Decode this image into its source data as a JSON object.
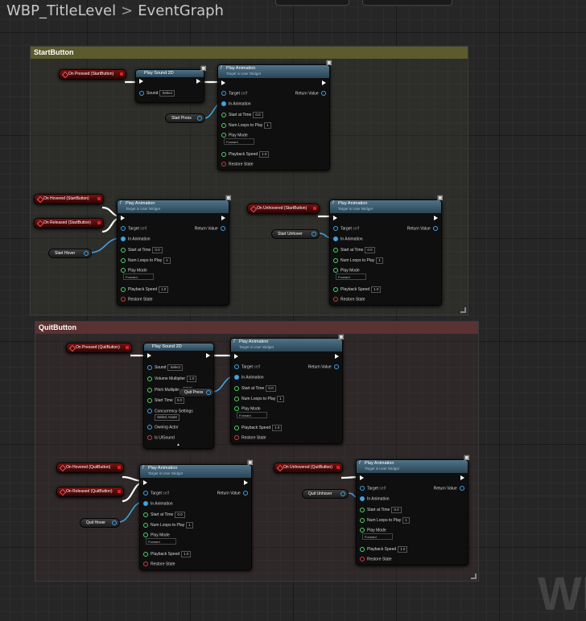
{
  "breadcrumb": {
    "blueprint": "WBP_TitleLevel",
    "separator": ">",
    "graph": "EventGraph"
  },
  "watermark": "WI",
  "colors": {
    "start_comment": "#5b5b2c",
    "quit_comment": "#5a3232",
    "exec_wire": "#ffffff",
    "data_wire": "#3fa3e5"
  },
  "comments": [
    {
      "title": "StartButton"
    },
    {
      "title": "QuitButton"
    }
  ],
  "play_sound": {
    "title": "Play Sound 2D",
    "sound_label": "Sound",
    "sound_value": "Select",
    "volume_label": "Volume Multiplier",
    "volume_value": "1.0",
    "pitch_label": "Pitch Multiplier",
    "pitch_value": "1.0",
    "start_time_label": "Start Time",
    "start_time_value": "0.0",
    "concurrency_label": "Concurrency Settings",
    "concurrency_value": "Select Asset",
    "owning_actor_label": "Owning Actor",
    "is_ui_sound_label": "Is UISound"
  },
  "play_anim": {
    "title": "Play Animation",
    "subtitle": "Target is User Widget",
    "target_label": "Target",
    "target_value": "self",
    "return_label": "Return Value",
    "in_anim_label": "In Animation",
    "start_label": "Start at Time",
    "start_value": "0.0",
    "loops_label": "Num Loops to Play",
    "loops_value": "1",
    "mode_label": "Play Mode",
    "mode_value": "Forward",
    "speed_label": "Playback Speed",
    "speed_value": "1.0",
    "restore_label": "Restore State"
  },
  "events": {
    "start_pressed": "On Pressed (StartButton)",
    "start_hovered": "On Hovered (StartButton)",
    "start_released": "On Released (StartButton)",
    "start_unhovered": "On Unhovered (StartButton)",
    "quit_pressed": "On Pressed (QuitButton)",
    "quit_hovered": "On Hovered (QuitButton)",
    "quit_released": "On Released (QuitButton)",
    "quit_unhovered": "On Unhovered (QuitButton)"
  },
  "variables": {
    "start_press": "Start Press",
    "start_hover": "Start Hover",
    "start_unhover": "Start Unhover",
    "quit_press": "Quit Press",
    "quit_hover": "Quit Hover",
    "quit_unhover": "Quit Unhover"
  }
}
